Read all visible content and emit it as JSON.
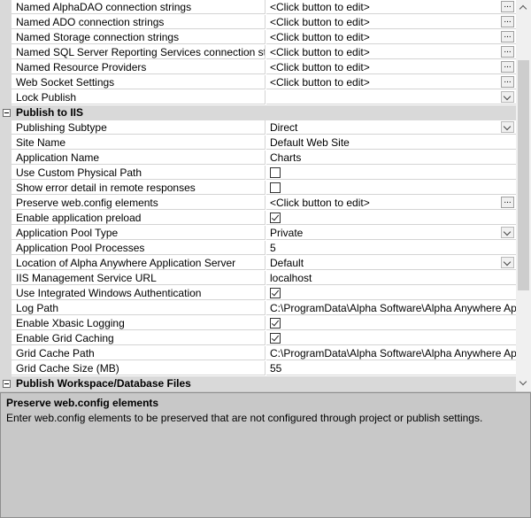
{
  "grid": {
    "rows": [
      {
        "type": "prop",
        "name": "Named AlphaDAO connection strings",
        "value": "<Click button to edit>",
        "editor": "ellipsis"
      },
      {
        "type": "prop",
        "name": "Named ADO connection strings",
        "value": "<Click button to edit>",
        "editor": "ellipsis"
      },
      {
        "type": "prop",
        "name": "Named Storage connection strings",
        "value": "<Click button to edit>",
        "editor": "ellipsis"
      },
      {
        "type": "prop",
        "name": "Named SQL Server Reporting Services connection strings",
        "value": "<Click button to edit>",
        "editor": "ellipsis"
      },
      {
        "type": "prop",
        "name": "Named Resource Providers",
        "value": "<Click button to edit>",
        "editor": "ellipsis"
      },
      {
        "type": "prop",
        "name": "Web Socket Settings",
        "value": "<Click button to edit>",
        "editor": "ellipsis"
      },
      {
        "type": "prop",
        "name": "Lock Publish",
        "value": "",
        "editor": "dropdown"
      },
      {
        "type": "category",
        "label": "Publish to IIS"
      },
      {
        "type": "prop",
        "name": "Publishing Subtype",
        "value": "Direct",
        "editor": "dropdown"
      },
      {
        "type": "prop",
        "name": "Site Name",
        "value": "Default Web Site",
        "editor": "none"
      },
      {
        "type": "prop",
        "name": "Application Name",
        "value": "Charts",
        "editor": "none"
      },
      {
        "type": "prop",
        "name": "Use Custom Physical Path",
        "value": "",
        "editor": "checkbox",
        "checked": false
      },
      {
        "type": "prop",
        "name": "Show error detail in remote responses",
        "value": "",
        "editor": "checkbox",
        "checked": false,
        "highlight": true
      },
      {
        "type": "prop",
        "name": "Preserve web.config elements",
        "value": "<Click button to edit>",
        "editor": "ellipsis",
        "highlight": true
      },
      {
        "type": "prop",
        "name": "Enable application preload",
        "value": "",
        "editor": "checkbox",
        "checked": true,
        "highlight": true
      },
      {
        "type": "prop",
        "name": "Application Pool Type",
        "value": "Private",
        "editor": "dropdown"
      },
      {
        "type": "prop",
        "name": "Application Pool Processes",
        "value": "5",
        "editor": "none"
      },
      {
        "type": "prop",
        "name": "Location of Alpha Anywhere Application Server",
        "value": "Default",
        "editor": "dropdown"
      },
      {
        "type": "prop",
        "name": "IIS Management Service URL",
        "value": "localhost",
        "editor": "none"
      },
      {
        "type": "prop",
        "name": "Use Integrated Windows Authentication",
        "value": "",
        "editor": "checkbox",
        "checked": true
      },
      {
        "type": "prop",
        "name": "Log Path",
        "value": "C:\\ProgramData\\Alpha Software\\Alpha Anywhere Applicat",
        "editor": "none"
      },
      {
        "type": "prop",
        "name": "Enable Xbasic Logging",
        "value": "",
        "editor": "checkbox",
        "checked": true
      },
      {
        "type": "prop",
        "name": "Enable Grid Caching",
        "value": "",
        "editor": "checkbox",
        "checked": true
      },
      {
        "type": "prop",
        "name": "Grid Cache Path",
        "value": "C:\\ProgramData\\Alpha Software\\Alpha Anywhere Applicat",
        "editor": "none"
      },
      {
        "type": "prop",
        "name": "Grid Cache Size (MB)",
        "value": "55",
        "editor": "none"
      },
      {
        "type": "category",
        "label": "Publish Workspace/Database Files"
      }
    ]
  },
  "ellipsis_label": "...",
  "description": {
    "title": "Preserve web.config elements",
    "text": "Enter web.config elements to be preserved that are not configured through project or publish settings."
  }
}
